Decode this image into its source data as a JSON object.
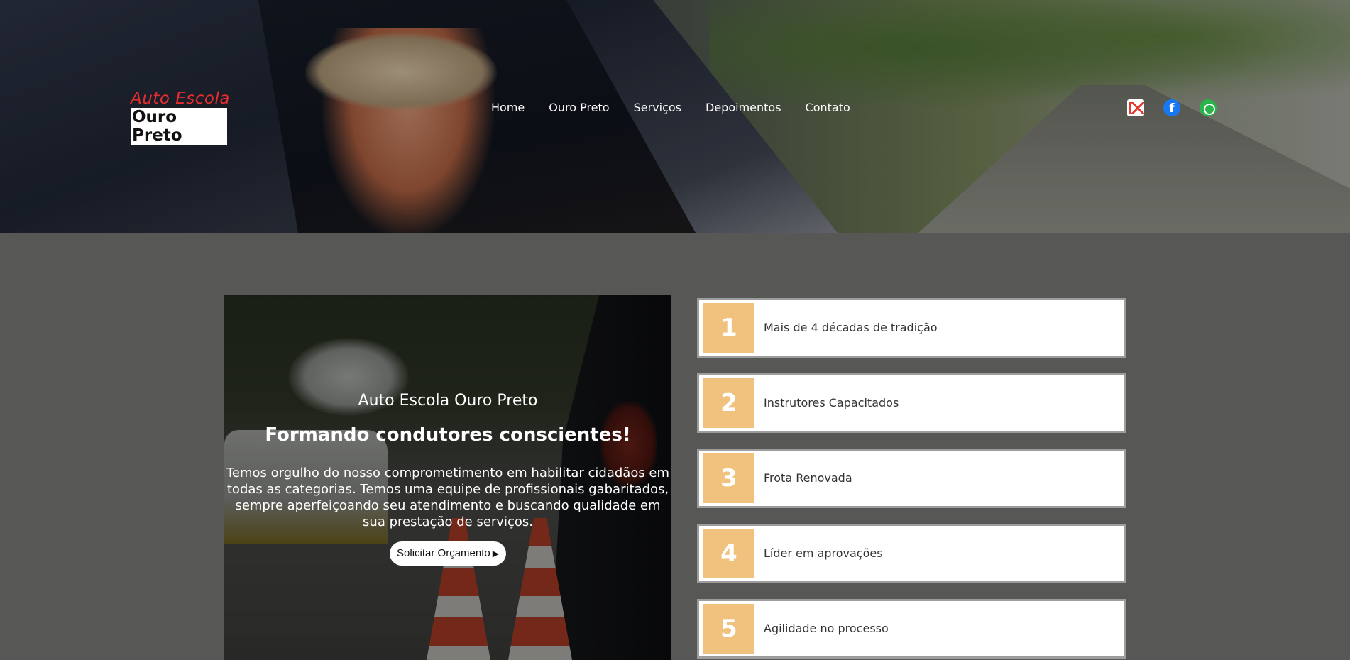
{
  "header": {
    "logo": {
      "line1": "Auto Escola",
      "line2": "Ouro Preto"
    },
    "nav": [
      "Home",
      "Ouro Preto",
      "Serviços",
      "Depoimentos",
      "Contato"
    ],
    "social_icons": [
      "gmail-icon",
      "facebook-icon",
      "whatsapp-icon"
    ]
  },
  "promo": {
    "kicker": "Auto Escola Ouro Preto",
    "headline": "Formando condutores conscientes!",
    "description": "Temos orgulho do nosso comprometimento em habilitar cidadãos em todas as categorias. Temos uma equipe de profissionais gabaritados, sempre aperfeiçoando seu atendimento e buscando qualidade em sua prestação de serviços.",
    "cta": "Solicitar Orçamento"
  },
  "features": [
    {
      "number": "1",
      "text": "Mais de 4 décadas de tradição"
    },
    {
      "number": "2",
      "text": "Instrutores Capacitados"
    },
    {
      "number": "3",
      "text": "Frota Renovada"
    },
    {
      "number": "4",
      "text": "Líder em aprovações"
    },
    {
      "number": "5",
      "text": "Agilidade no processo"
    }
  ],
  "colors": {
    "page_background": "#575755",
    "accent_number": "#f1c27d",
    "logo_red": "#e52d2d"
  }
}
